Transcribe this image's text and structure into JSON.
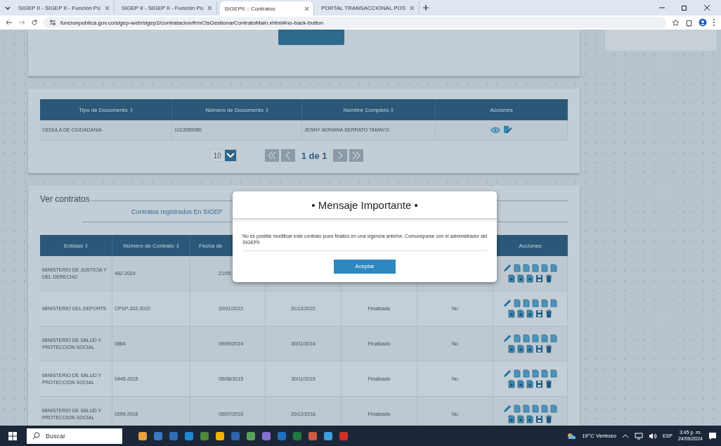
{
  "browser": {
    "tabs": [
      {
        "title": "SIGEP II - SIGEP II - Función Pú",
        "selected": false
      },
      {
        "title": "SIGEP II - SIGEP II - Función Pú",
        "selected": false
      },
      {
        "title": "SIGEPII :: Contratos",
        "selected": true
      },
      {
        "title": "PORTAL TRANSACCIONAL POS",
        "selected": false
      }
    ],
    "address": "funcionpublica.gov.co/sigep-web/sigep2/contratacion/frmCtsGestionarContratoMain.xhtml#no-back-button"
  },
  "persons_table": {
    "columns": [
      {
        "label": "Tipo de Documento",
        "sortable": true
      },
      {
        "label": "Número de Documento",
        "sortable": true
      },
      {
        "label": "Nombre Completo",
        "sortable": true
      },
      {
        "label": "Acciones",
        "sortable": false
      }
    ],
    "rows": [
      [
        "CEDULA DE CIUDADANIA",
        "1013589080",
        "JENNY ADRIANA SERRATO TAMAYO"
      ]
    ],
    "page_size": "10",
    "page_info": "1 de 1"
  },
  "contracts": {
    "legend": "Ver contratos",
    "subtitle": "Contratos registrados En SIGEP",
    "columns": [
      {
        "label": "Entidad",
        "sortable": true
      },
      {
        "label": "Número de Contrato",
        "sortable": true
      },
      {
        "label": "Fecha de",
        "sortable": false
      }
    ],
    "actions_column": "Acciones",
    "rows": [
      [
        "MINISTERIO DE JUSTICIA Y DEL DERECHO",
        "482-2024",
        "21/05"
      ],
      [
        "MINISTERIO DEL DEPORTE",
        "CPSP-202-2022",
        "20/01/2022",
        "31/12/2022",
        "Finalizado",
        "No"
      ],
      [
        "MINISTERIO DE SALUD Y PROTECCION SOCIAL",
        "0864",
        "09/09/2014",
        "30/11/2014",
        "Finalizado",
        "No"
      ],
      [
        "MINISTERIO DE SALUD Y PROTECCION SOCIAL",
        "0445-2015",
        "05/08/2015",
        "30/11/2015",
        "Finalizado",
        "No"
      ],
      [
        "MINISTERIO DE SALUD Y PROTECCION SOCIAL",
        "0299-2016",
        "05/07/2016",
        "20/12/2016",
        "Finalizado",
        "No"
      ]
    ]
  },
  "dialog": {
    "title": "• Mensaje Importante •",
    "message": "No es posible modificar este contrato pues finalizó en una vigencia anterior. Comuníquese con el administrador del SIGEPII",
    "button": "Aceptar"
  },
  "taskbar": {
    "search": "Buscar",
    "weather": "19°C Ventoso",
    "language": "ESP",
    "time": "3:45 p. m.",
    "date": "24/09/2024"
  }
}
